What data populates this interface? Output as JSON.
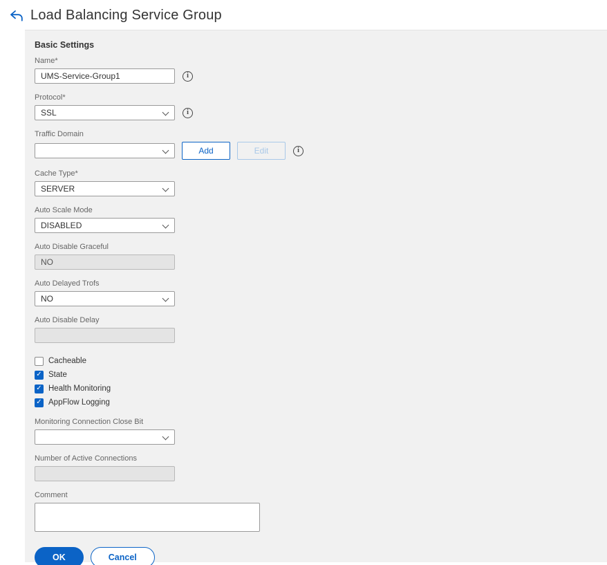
{
  "header": {
    "title": "Load Balancing Service Group"
  },
  "icons": {
    "back": "back-arrow",
    "info": "i",
    "check": "✓"
  },
  "section": {
    "title": "Basic Settings"
  },
  "form": {
    "name": {
      "label": "Name*",
      "value": "UMS-Service-Group1"
    },
    "protocol": {
      "label": "Protocol*",
      "value": "SSL"
    },
    "traffic_domain": {
      "label": "Traffic Domain",
      "value": "",
      "add_label": "Add",
      "edit_label": "Edit"
    },
    "cache_type": {
      "label": "Cache Type*",
      "value": "SERVER"
    },
    "auto_scale_mode": {
      "label": "Auto Scale Mode",
      "value": "DISABLED"
    },
    "auto_disable_graceful": {
      "label": "Auto Disable Graceful",
      "value": "NO"
    },
    "auto_delayed_trofs": {
      "label": "Auto Delayed Trofs",
      "value": "NO"
    },
    "auto_disable_delay": {
      "label": "Auto Disable Delay",
      "value": ""
    },
    "checkboxes": {
      "cacheable": {
        "label": "Cacheable",
        "checked": false
      },
      "state": {
        "label": "State",
        "checked": true
      },
      "health_monitoring": {
        "label": "Health Monitoring",
        "checked": true
      },
      "appflow_logging": {
        "label": "AppFlow Logging",
        "checked": true
      }
    },
    "monitoring_connection_close_bit": {
      "label": "Monitoring Connection Close Bit",
      "value": ""
    },
    "number_of_active_connections": {
      "label": "Number of Active Connections",
      "value": ""
    },
    "comment": {
      "label": "Comment",
      "value": ""
    }
  },
  "actions": {
    "ok": "OK",
    "cancel": "Cancel"
  },
  "colors": {
    "primary_blue": "#0b63c6",
    "disabled_blue": "#a8c8e8",
    "panel_bg": "#f1f1f1",
    "disabled_input_bg": "#e4e4e4"
  }
}
